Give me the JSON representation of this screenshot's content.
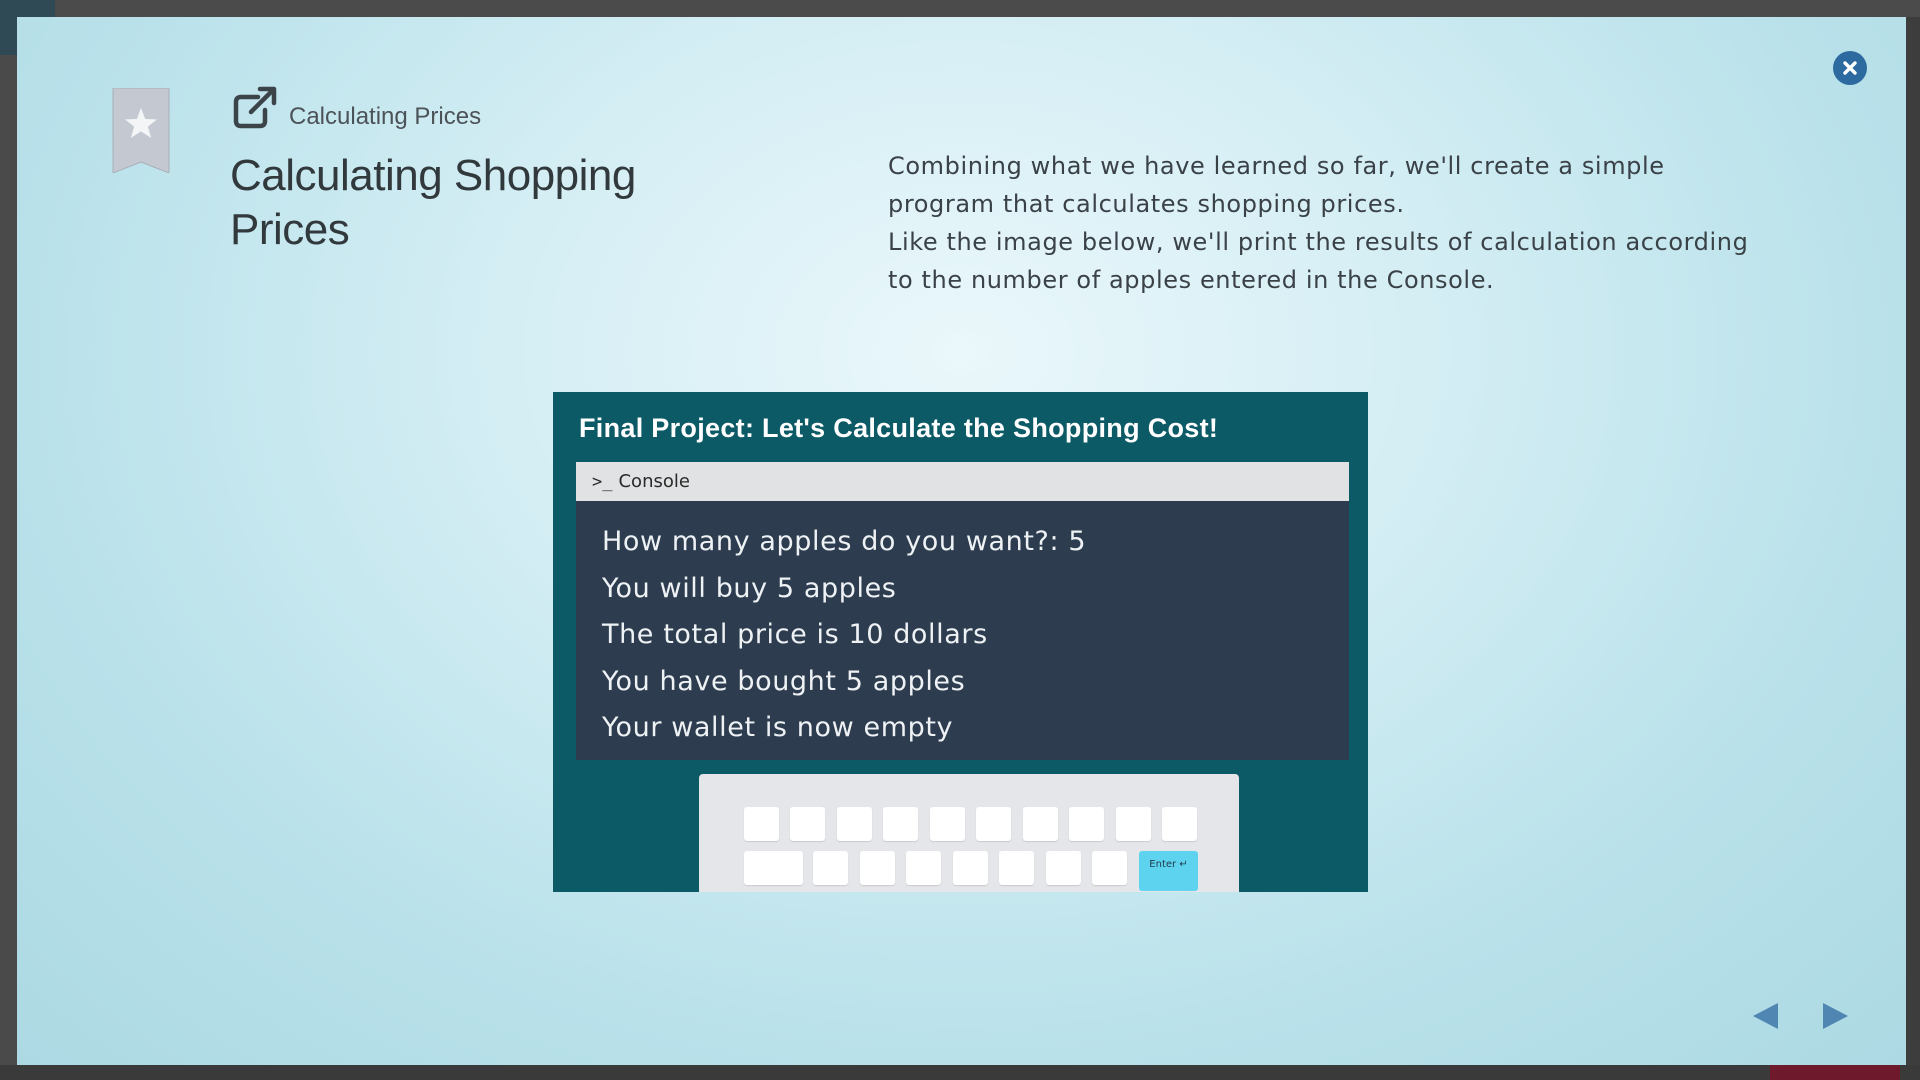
{
  "colors": {
    "accent": "#2c6aa0",
    "figure_bg": "#0d5a67",
    "console_bg": "#2d3d4f",
    "enter_key": "#5dd3f0"
  },
  "icons": {
    "close": "close-icon",
    "bookmark": "bookmark-star-icon",
    "external_link": "external-link-icon",
    "prev": "triangle-left-icon",
    "next": "triangle-right-icon"
  },
  "header": {
    "breadcrumb": "Calculating Prices",
    "title": "Calculating Shopping Prices"
  },
  "description": {
    "paragraph1": "Combining what we have learned so far, we'll create a simple program that calculates shopping prices.",
    "paragraph2": "Like the image below, we'll print the results of calculation according to the number of apples entered in the Console."
  },
  "figure": {
    "title": "Final Project: Let's Calculate the Shopping Cost!",
    "console_label": "Console",
    "console_lines": [
      "How many apples do you want?: 5",
      "You will buy 5 apples",
      "The total price is 10 dollars",
      "You have bought 5 apples",
      "Your wallet is now empty"
    ],
    "enter_key_label": "Enter ↵"
  }
}
